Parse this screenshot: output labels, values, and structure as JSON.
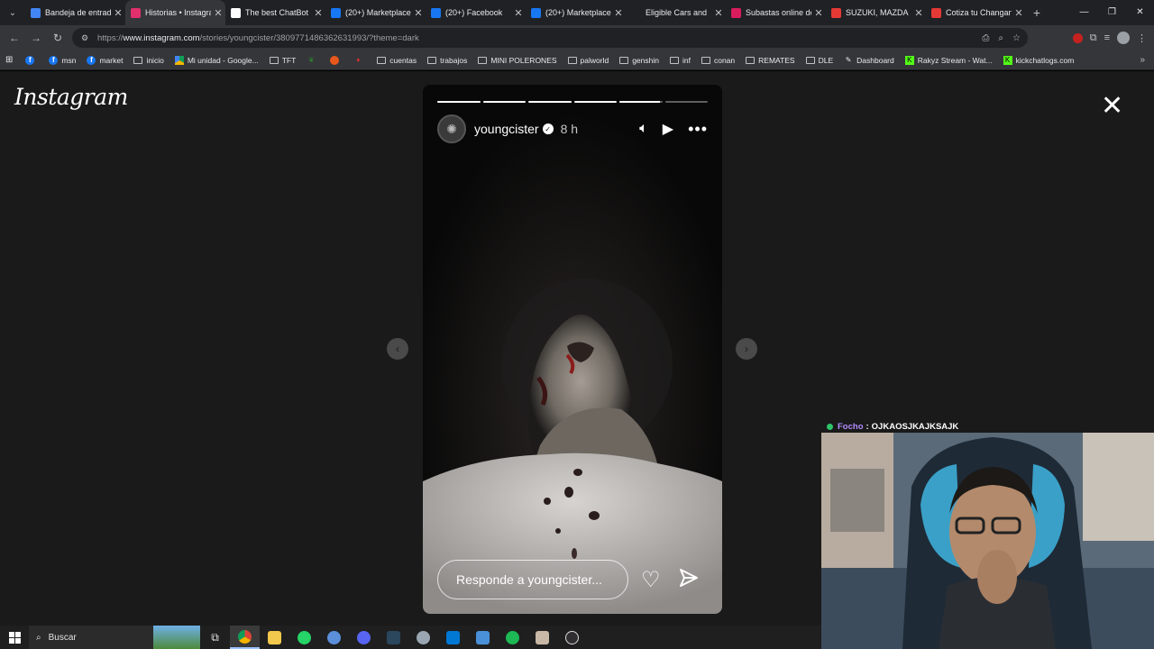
{
  "browser": {
    "tabs": [
      {
        "title": "Bandeja de entrada",
        "icon": "gmail-icon",
        "color": "#4285f4",
        "active": false
      },
      {
        "title": "Historias • Instagram",
        "icon": "instagram-icon",
        "color": "#e1306c",
        "active": true
      },
      {
        "title": "The best ChatBot",
        "icon": "chatbot-icon",
        "color": "#ffffff",
        "active": false
      },
      {
        "title": "(20+) Marketplace",
        "icon": "facebook-icon",
        "color": "#1877f2",
        "active": false
      },
      {
        "title": "(20+) Facebook",
        "icon": "facebook-icon",
        "color": "#1877f2",
        "active": false
      },
      {
        "title": "(20+) Marketplace",
        "icon": "facebook-icon",
        "color": "#1877f2",
        "active": false
      },
      {
        "title": "Eligible Cars and",
        "icon": "copart-icon",
        "color": "#202124",
        "active": false
      },
      {
        "title": "Subastas online de",
        "icon": "subastas-icon",
        "color": "#d91c5c",
        "active": false
      },
      {
        "title": "SUZUKI, MAZDA",
        "icon": "red-circle-icon",
        "color": "#e53935",
        "active": false
      },
      {
        "title": "Cotiza tu Changan",
        "icon": "red-circle-icon",
        "color": "#e53935",
        "active": false
      }
    ],
    "url": {
      "prefix": "https://",
      "host": "www.instagram.com",
      "rest": "/stories/youngcister/3809771486362631993/?theme=dark"
    },
    "bookmarks": [
      {
        "label": "",
        "icon": "facebook-icon"
      },
      {
        "label": "msn",
        "icon": "facebook-icon"
      },
      {
        "label": "market",
        "icon": "facebook-icon"
      },
      {
        "label": "inicio",
        "icon": "folder-icon"
      },
      {
        "label": "Mi unidad - Google...",
        "icon": "drive-icon"
      },
      {
        "label": "TFT",
        "icon": "folder-icon"
      },
      {
        "label": "",
        "icon": "leaf-icon"
      },
      {
        "label": "",
        "icon": "orange-icon"
      },
      {
        "label": "",
        "icon": "red-icon"
      },
      {
        "label": "cuentas",
        "icon": "folder-icon"
      },
      {
        "label": "trabajos",
        "icon": "folder-icon"
      },
      {
        "label": "MINI POLERONES",
        "icon": "folder-icon"
      },
      {
        "label": "palworld",
        "icon": "folder-icon"
      },
      {
        "label": "genshin",
        "icon": "folder-icon"
      },
      {
        "label": "inf",
        "icon": "folder-icon"
      },
      {
        "label": "conan",
        "icon": "folder-icon"
      },
      {
        "label": "REMATES",
        "icon": "folder-icon"
      },
      {
        "label": "DLE",
        "icon": "folder-icon"
      },
      {
        "label": "Dashboard",
        "icon": "dashboard-icon"
      },
      {
        "label": "Rakyz Stream - Wat...",
        "icon": "kick-icon"
      },
      {
        "label": "kickchatlogs.com",
        "icon": "kick-icon"
      }
    ]
  },
  "instagram": {
    "logo": "Instagram",
    "story": {
      "username": "youngcister",
      "time_ago": "8 h",
      "progress": [
        1,
        1,
        1,
        1,
        0.95,
        0
      ],
      "reply_placeholder": "Responde a youngcister..."
    }
  },
  "overlay": {
    "chat_user": "Focho",
    "chat_sep": ":",
    "chat_message": "OJKAOSJKAJKSAJK"
  },
  "taskbar": {
    "search_label": "Buscar",
    "apps": [
      "task-view-icon",
      "chrome-icon",
      "file-explorer-icon",
      "whatsapp-icon",
      "app-icon",
      "discord-icon",
      "steam-icon",
      "game-icon",
      "outlook-icon",
      "calculator-icon",
      "spotify-icon",
      "photo-app-icon",
      "obs-icon"
    ]
  }
}
